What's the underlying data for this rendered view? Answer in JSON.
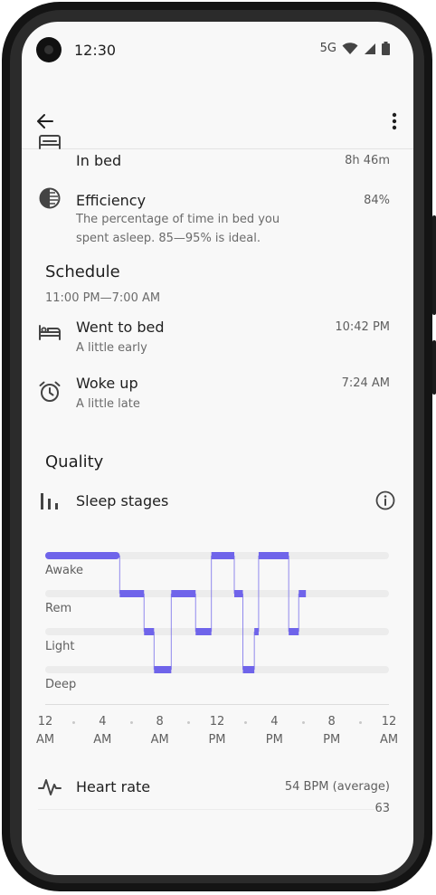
{
  "status_bar": {
    "time": "12:30",
    "network": "5G"
  },
  "app_bar": {
    "back_icon": "arrow-back-icon",
    "menu_icon": "more-vert-icon"
  },
  "in_bed": {
    "label": "In bed",
    "value": "8h 46m",
    "icon": "bed-icon"
  },
  "efficiency": {
    "label": "Efficiency",
    "value": "84%",
    "description_line1": "The percentage of time in bed you",
    "description_line2": "spent asleep. 85—95% is ideal.",
    "icon": "efficiency-icon"
  },
  "schedule": {
    "title": "Schedule",
    "range": "11:00 PM—7:00 AM",
    "went_to_bed": {
      "label": "Went to bed",
      "sub": "A little early",
      "time": "10:42 PM",
      "icon": "hotel-bed-icon"
    },
    "woke_up": {
      "label": "Woke up",
      "sub": "A little late",
      "time": "7:24 AM",
      "icon": "alarm-icon"
    }
  },
  "quality": {
    "title": "Quality",
    "sleep_stages": {
      "label": "Sleep stages",
      "icon": "bar-chart-icon",
      "info_icon": "info-icon"
    }
  },
  "chart_data": {
    "type": "line",
    "stages": [
      "Awake",
      "Rem",
      "Light",
      "Deep"
    ],
    "x_ticks": [
      {
        "line1": "12",
        "line2": "AM"
      },
      {
        "line1": "4",
        "line2": "AM"
      },
      {
        "line1": "8",
        "line2": "AM"
      },
      {
        "line1": "12",
        "line2": "PM"
      },
      {
        "line1": "4",
        "line2": "PM"
      },
      {
        "line1": "8",
        "line2": "PM"
      },
      {
        "line1": "12",
        "line2": "AM"
      }
    ],
    "x_range_hours": [
      0,
      24
    ],
    "accent_color": "#6f64ea",
    "segments": [
      {
        "stage": "Awake",
        "start": 0.0,
        "end": 5.2
      },
      {
        "stage": "Rem",
        "start": 5.2,
        "end": 6.9
      },
      {
        "stage": "Light",
        "start": 6.9,
        "end": 7.6
      },
      {
        "stage": "Deep",
        "start": 7.6,
        "end": 8.8
      },
      {
        "stage": "Rem",
        "start": 8.8,
        "end": 10.5
      },
      {
        "stage": "Light",
        "start": 10.5,
        "end": 11.6
      },
      {
        "stage": "Awake",
        "start": 11.6,
        "end": 13.2
      },
      {
        "stage": "Rem",
        "start": 13.2,
        "end": 13.8
      },
      {
        "stage": "Deep",
        "start": 13.8,
        "end": 14.6
      },
      {
        "stage": "Light",
        "start": 14.6,
        "end": 14.9
      },
      {
        "stage": "Awake",
        "start": 14.9,
        "end": 17.0
      },
      {
        "stage": "Light",
        "start": 17.0,
        "end": 17.7
      },
      {
        "stage": "Rem",
        "start": 17.7,
        "end": 18.2
      }
    ]
  },
  "heart_rate": {
    "label": "Heart rate",
    "value": "54 BPM (average)",
    "icon": "heart-rate-icon",
    "axis_value": "63"
  }
}
